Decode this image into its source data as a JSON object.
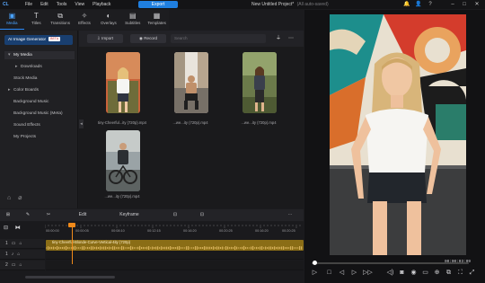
{
  "menubar": {
    "logo": "CL",
    "items": [
      "File",
      "Edit",
      "Tools",
      "View",
      "Playback"
    ],
    "export_label": "Export",
    "title": "New Untitled Project*",
    "saved_note": "(All auto-saved)"
  },
  "rooms": [
    {
      "label": "Media",
      "icon": "media-icon"
    },
    {
      "label": "Titles",
      "icon": "titles-icon"
    },
    {
      "label": "Transitions",
      "icon": "transitions-icon"
    },
    {
      "label": "Effects",
      "icon": "effects-icon"
    },
    {
      "label": "Overlays",
      "icon": "overlays-icon"
    },
    {
      "label": "Subtitles",
      "icon": "subtitles-icon"
    },
    {
      "label": "Templates",
      "icon": "templates-icon"
    }
  ],
  "sidebar": {
    "ai_button": "AI Image Generator",
    "beta": "BETA",
    "items": [
      {
        "label": "My Media",
        "arrow": "▾"
      },
      {
        "label": "Downloads",
        "arrow": "▸"
      },
      {
        "label": "Stock Media",
        "arrow": ""
      },
      {
        "label": "Color Boards",
        "arrow": "▸"
      },
      {
        "label": "Background Music",
        "arrow": ""
      },
      {
        "label": "Background Music (Meta)",
        "arrow": ""
      },
      {
        "label": "Sound Effects",
        "arrow": ""
      },
      {
        "label": "My Projects",
        "arrow": ""
      }
    ]
  },
  "media_toolbar": {
    "import_label": "Import",
    "record_label": "Record",
    "search_placeholder": "Search"
  },
  "media_items": [
    {
      "label": "tiny-Cheerful...ity (720p).mp4"
    },
    {
      "label": "...we...ity (720p).mp4"
    },
    {
      "label": "...we...ity (720p).mp4"
    },
    {
      "label": "...we...ity (720p).mp4"
    }
  ],
  "preview": {
    "timecode": "00:00:03:09"
  },
  "timeline_toolbar": {
    "edit_label": "Edit",
    "keyframe_label": "Keyframe"
  },
  "ruler_ticks": [
    "00:00:00",
    "00:00:05",
    "00:08:10",
    "00:12:15",
    "00:16:20",
    "00:20:25",
    "00:16:20",
    "00:20:25"
  ],
  "clip": {
    "title": "tiny-Cheerful-Blonde-Curve-Vertical-4ity (720p)"
  },
  "colors": {
    "accent": "#1f7fe0",
    "clip": "#8a6d16",
    "playhead": "#f08a1a"
  }
}
